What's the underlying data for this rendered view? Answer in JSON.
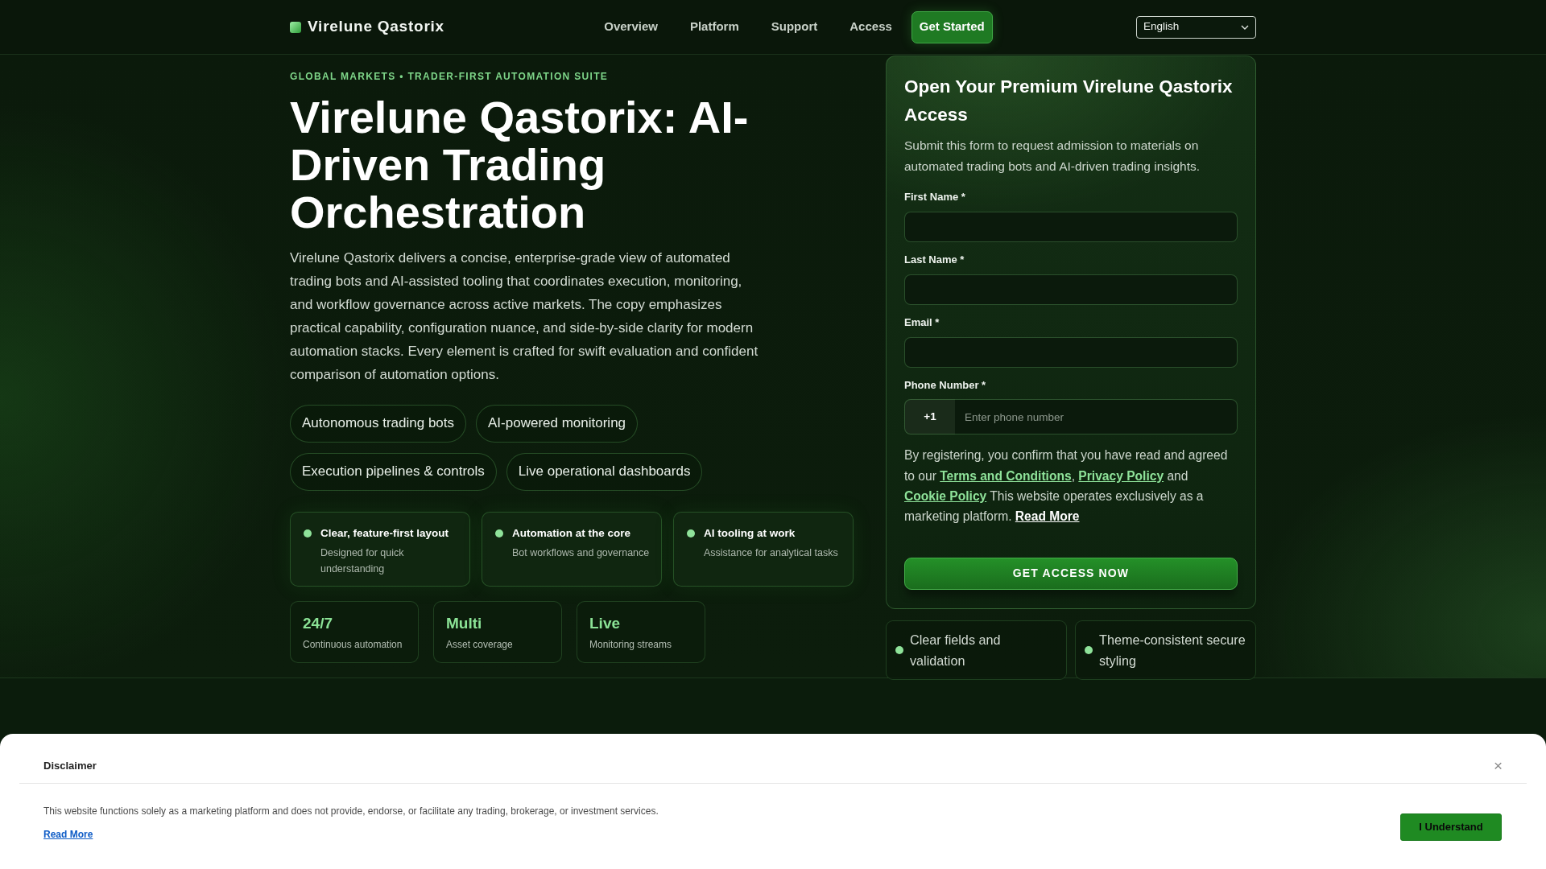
{
  "navbar": {
    "brand": "Virelune Qastorix",
    "links": [
      "Overview",
      "Platform",
      "Support",
      "Access"
    ],
    "cta": "Get Started",
    "language": "English"
  },
  "hero": {
    "eyebrow": "GLOBAL MARKETS • TRADER-FIRST AUTOMATION SUITE",
    "title": "Virelune Qastorix: AI-Driven Trading Orchestration",
    "description": "Virelune Qastorix delivers a concise, enterprise-grade view of automated trading bots and AI-assisted tooling that coordinates execution, monitoring, and workflow governance across active markets. The copy emphasizes practical capability, configuration nuance, and side-by-side clarity for modern automation stacks. Every element is crafted for swift evaluation and confident comparison of automation options.",
    "pills": [
      "Autonomous trading bots",
      "AI-powered monitoring",
      "Execution pipelines & controls",
      "Live operational dashboards"
    ],
    "features": [
      {
        "title": "Clear, feature-first layout",
        "subtitle": "Designed for quick understanding"
      },
      {
        "title": "Automation at the core",
        "subtitle": "Bot workflows and governance"
      },
      {
        "title": "AI tooling at work",
        "subtitle": "Assistance for analytical tasks"
      }
    ],
    "stats": [
      {
        "value": "24/7",
        "label": "Continuous automation"
      },
      {
        "value": "Multi",
        "label": "Asset coverage"
      },
      {
        "value": "Live",
        "label": "Monitoring streams"
      }
    ]
  },
  "access_form": {
    "title": "Open Your Premium Virelune Qastorix Access",
    "description": "Submit this form to request admission to materials on automated trading bots and AI-driven trading insights.",
    "fields": [
      {
        "kind": "text",
        "label": "First Name *"
      },
      {
        "kind": "text",
        "label": "Last Name *"
      },
      {
        "kind": "text",
        "label": "Email *"
      },
      {
        "kind": "phone",
        "label": "Phone Number *",
        "prefix": "+1",
        "placeholder": "Enter phone number"
      }
    ],
    "consent": [
      {
        "kind": "text",
        "text": "By registering, you confirm that you have read and agreed to our "
      },
      {
        "kind": "link",
        "text": "Terms and Conditions"
      },
      {
        "kind": "text",
        "text": ", "
      },
      {
        "kind": "link",
        "text": "Privacy Policy"
      },
      {
        "kind": "text",
        "text": " and "
      },
      {
        "kind": "link",
        "text": "Cookie Policy"
      },
      {
        "kind": "text",
        "text": " This website operates exclusively as a marketing platform. "
      },
      {
        "kind": "more",
        "text": "Read More"
      }
    ],
    "submit": "GET ACCESS NOW",
    "highlights": [
      "Clear fields and validation",
      "Theme-consistent secure styling"
    ]
  },
  "disclaimer": {
    "title": "Disclaimer",
    "close": "×",
    "text": "This website functions solely as a marketing platform and does not provide, endorse, or facilitate any trading, brokerage, or investment services.",
    "link": "Read More",
    "button": "I Understand"
  }
}
